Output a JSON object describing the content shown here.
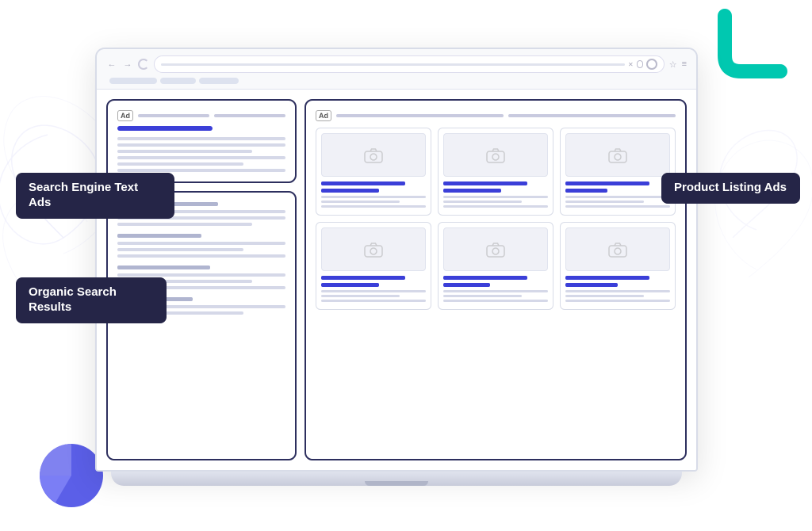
{
  "labels": {
    "search_engine_text_ads": "Search Engine Text Ads",
    "organic_search_results": "Organic Search Results",
    "product_listing_ads": "Product Listing Ads"
  },
  "browser": {
    "ad_badge": "Ad",
    "ad_badge2": "Ad"
  },
  "colors": {
    "teal": "#00c8b0",
    "dark_navy": "#252547",
    "blue_accent": "#3b3fd8",
    "blue_pie": "#5b5fe8",
    "bg_lines": "#e8eaf5"
  }
}
